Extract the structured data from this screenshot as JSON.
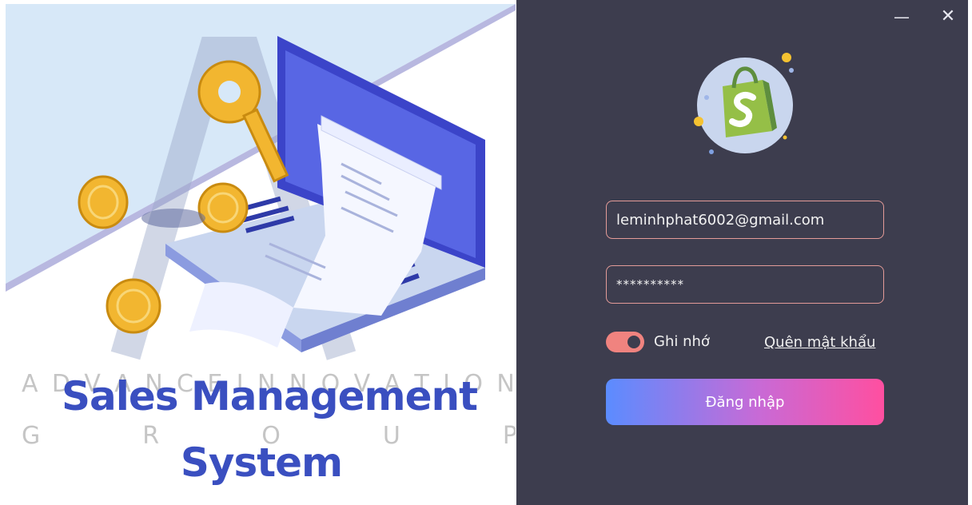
{
  "illustration": {
    "title_line1": "Sales Management",
    "title_line2": "System",
    "watermark_top": [
      "A",
      "D",
      "V",
      "A",
      "N",
      "C",
      "E",
      "I",
      "N",
      "N",
      "O",
      "V",
      "A",
      "T",
      "I",
      "O",
      "N"
    ],
    "watermark_bottom": [
      "G",
      "R",
      "O",
      "U",
      "P"
    ]
  },
  "window_controls": {
    "minimize_label": "—",
    "close_label": "✕"
  },
  "login": {
    "email_value": "leminhphat6002@gmail.com",
    "password_value": "**********",
    "remember_label": "Ghi nhớ",
    "remember_checked": true,
    "forgot_label": "Quên mật khẩu",
    "login_button_label": "Đăng nhập"
  },
  "colors": {
    "panel_bg": "#3d3d4e",
    "field_border": "#e39b98",
    "toggle_on": "#f0837f",
    "button_gradient_start": "#5b8cff",
    "button_gradient_end": "#ff4fa0",
    "title_blue": "#3a4fc0"
  }
}
